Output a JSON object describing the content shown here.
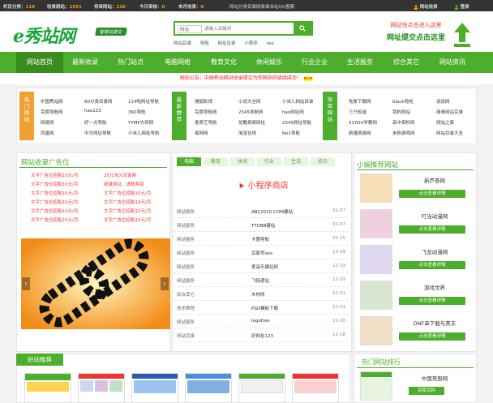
{
  "topbar": {
    "stats": [
      {
        "label": "栏目分类：",
        "value": "118"
      },
      {
        "label": "收录网站：",
        "value": "1551"
      },
      {
        "label": "待审网站：",
        "value": "126"
      },
      {
        "label": "今日审核：",
        "value": "0"
      },
      {
        "label": "本月收录：",
        "value": "0"
      }
    ],
    "notice": "网站分类目录网收录本站QQ客服",
    "submit": "网站收录",
    "login": "登录"
  },
  "header": {
    "logo_text": "秀站网",
    "logo_slogan": "智建站提交",
    "search": {
      "select_label": "网站",
      "placeholder": "请输入关键词",
      "hotwords": [
        "网站目录",
        "导航",
        "网址目录",
        "小程序",
        "seo"
      ]
    },
    "promo": {
      "line1": "网站快点击进入这里",
      "line2": "网址提交点击这里"
    }
  },
  "nav": [
    "网站首页",
    "最新收录",
    "热门站点",
    "电脑网络",
    "教育文化",
    "休闲娱乐",
    "行业企业",
    "生活服务",
    "综合其它",
    "网站资讯"
  ],
  "notice": {
    "label": "网站公告：",
    "text": "中国秀站网对收录提交为你网站的链接成功！",
    "badge": "NEW"
  },
  "categories": {
    "groups": [
      {
        "title": "热门网站",
        "color": "#f0a030"
      },
      {
        "title": "最新推荐",
        "color": "#4cae2c"
      },
      {
        "title": "快审网站",
        "color": "#4cae2c"
      }
    ],
    "col1": [
      [
        "中国秀站网",
        "80分类目录网",
        "114啦网址导航"
      ],
      [
        "百度导航网",
        "hao123",
        "360导航"
      ],
      [
        "网易网",
        "好一点导航",
        "YYMP大师网"
      ],
      [
        "凤凰网",
        "中文网址导航",
        "小米儿网址导航"
      ]
    ],
    "col2": [
      [
        "搜狐影视",
        "小说大全网",
        "小米儿网站目录"
      ],
      [
        "百度导航网",
        "2345导航网",
        "hao网址网"
      ],
      [
        "爱奇艺导航",
        "优酷视频网址",
        "2345网址导航"
      ],
      [
        "易网网",
        "淘宝在线",
        "No1导航"
      ]
    ],
    "col3": [
      [
        "免费下载网",
        "black啦啦",
        "说说网"
      ],
      [
        "三只松鼠",
        "我的网站",
        "简单网站目录"
      ],
      [
        "51YOU学教网",
        "高中资料网",
        "网站之家"
      ],
      [
        "新疆旅游网",
        "米粉游戏网",
        "网站目录大全"
      ]
    ]
  },
  "ads": {
    "title": "网站收录广告位",
    "rows": [
      [
        "文字广告位招租10元/月",
        "25元永久目录网"
      ],
      [
        "文字广告位招租10元/月",
        "收录网址，请联系我"
      ],
      [
        "文字广告位招租10元/月",
        "文字广告位招租10元/月"
      ],
      [
        "文字广告位招租10元/月",
        "文字广告位招租10元/月"
      ],
      [
        "文字广告位招租10元/月",
        "文字广告位招租10元/月"
      ],
      [
        "文字广告位招租10元/月",
        "文字广告位招租10元/月"
      ]
    ]
  },
  "latest": {
    "tabs": [
      "电脑",
      "教育",
      "休闲",
      "行业",
      "生活",
      "综合"
    ],
    "headline": "小程序商店",
    "rows": [
      {
        "cat": "网站服务",
        "name": "ABC2010.COM建站",
        "date": "01-07"
      },
      {
        "cat": "网站服务",
        "name": "TTOBB建站",
        "date": "01-07"
      },
      {
        "cat": "网站服务",
        "name": "卡盟导航",
        "date": "01-15"
      },
      {
        "cat": "网站服务",
        "name": "百家号seo",
        "date": "12-29"
      },
      {
        "cat": "网站服务",
        "name": "爱采乐建站网",
        "date": "12-29"
      },
      {
        "cat": "网站服务",
        "name": "飞扬源站",
        "date": "12-29"
      },
      {
        "cat": "综合其它",
        "name": "木材网",
        "date": "12-01"
      },
      {
        "cat": "技术教程",
        "name": "PSD模板下载",
        "date": "12-01"
      },
      {
        "cat": "网站服务",
        "name": "logofree",
        "date": "11-20"
      },
      {
        "cat": "网站目录",
        "name": "好网址123",
        "date": "11-18"
      }
    ]
  },
  "recommend": {
    "title": "小编推荐网站",
    "btn_label": "点击查看详情",
    "items": [
      "新芦荟网",
      "叮当动漫网",
      "飞龙动漫网",
      "游戏世界",
      "DNF单下载与美丰"
    ]
  },
  "good_sites": {
    "title": "好站推荐"
  },
  "rank": {
    "title": "热门网站排行",
    "first_name": "中国美股网",
    "first_btn": "百度百科"
  }
}
